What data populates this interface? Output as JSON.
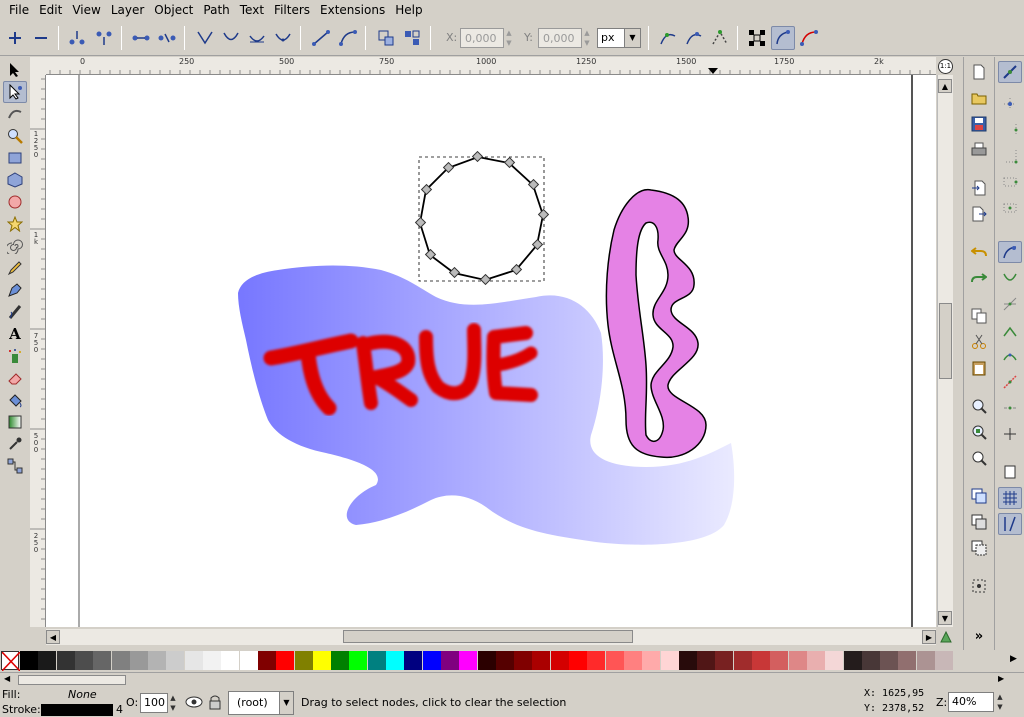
{
  "menu": {
    "items": [
      "File",
      "Edit",
      "View",
      "Layer",
      "Object",
      "Path",
      "Text",
      "Filters",
      "Extensions",
      "Help"
    ]
  },
  "toolbar": {
    "x_label": "X:",
    "x_value": "0,000",
    "y_label": "Y:",
    "y_value": "0,000",
    "unit": "px"
  },
  "ruler": {
    "h_labels": [
      "0",
      "250",
      "500",
      "750",
      "1000",
      "1250",
      "1500",
      "1750",
      "2k"
    ],
    "v_label_groups": [
      [
        "1",
        "2",
        "5",
        "0"
      ],
      [
        "1",
        "k"
      ],
      [
        "7",
        "5",
        "0"
      ],
      [
        "5",
        "0",
        "0"
      ],
      [
        "2",
        "5",
        "0"
      ]
    ],
    "zoom_badge": "1:1"
  },
  "canvas": {
    "text_art": "TRUE",
    "colors": {
      "blob_gradient_start": "#7777ff",
      "blob_gradient_end": "#eaeaff",
      "text_fill": "#dd0000",
      "shape_fill": "#e582e5",
      "shape_stroke": "#000000"
    }
  },
  "palette": {
    "swatches": [
      "#000000",
      "#1a1a1a",
      "#333333",
      "#4d4d4d",
      "#666666",
      "#808080",
      "#999999",
      "#b3b3b3",
      "#cccccc",
      "#e6e6e6",
      "#f2f2f2",
      "#ffffff",
      "#ffffff",
      "#800000",
      "#ff0000",
      "#808000",
      "#ffff00",
      "#008000",
      "#00ff00",
      "#008080",
      "#00ffff",
      "#000080",
      "#0000ff",
      "#800080",
      "#ff00ff",
      "#2b0000",
      "#550000",
      "#800000",
      "#aa0000",
      "#d40000",
      "#ff0000",
      "#ff2a2a",
      "#ff5555",
      "#ff8080",
      "#ffaaaa",
      "#ffd5d5",
      "#280b0b",
      "#501616",
      "#782121",
      "#a02c2c",
      "#c83737",
      "#d35f5f",
      "#de8787",
      "#e9afaf",
      "#f4d7d7",
      "#241c1c",
      "#483737",
      "#6c5353",
      "#916f6f",
      "#ac9393",
      "#c8b7b7"
    ]
  },
  "status": {
    "fill_label": "Fill:",
    "fill_value": "None",
    "stroke_label": "Stroke:",
    "stroke_width": "4",
    "opacity_label": "O:",
    "opacity_value": "100",
    "layer_value": "(root)",
    "message": "Drag to select nodes, click to clear the selection",
    "x_readout": "X: 1625,95",
    "y_readout": "Y: 2378,52",
    "zoom_label": "Z:",
    "zoom_value": "40%"
  }
}
